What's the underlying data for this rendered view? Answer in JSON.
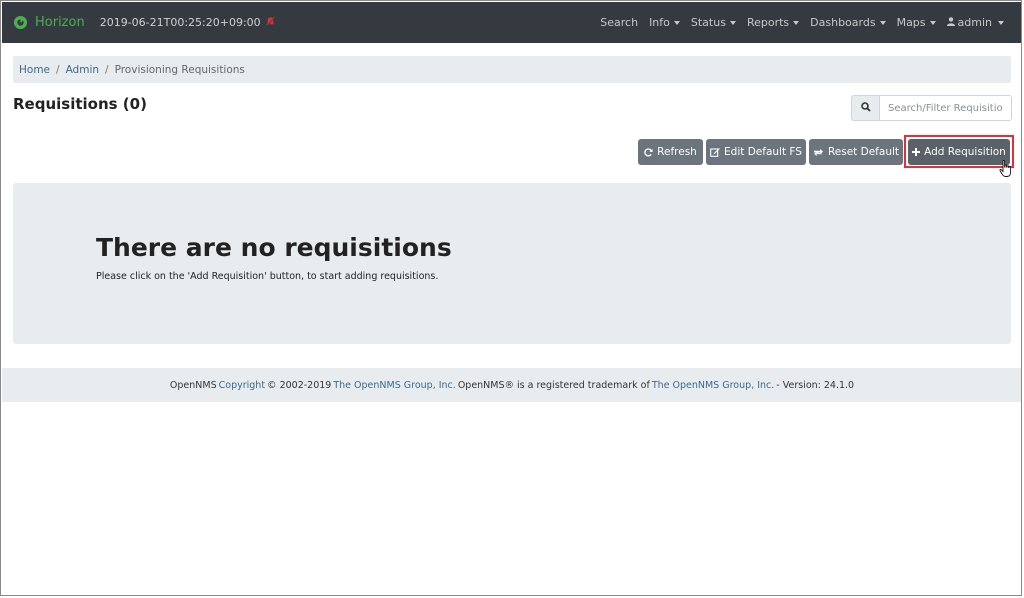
{
  "navbar": {
    "brand": "Horizon",
    "timestamp": "2019-06-21T00:25:20+09:00",
    "items": [
      {
        "label": "Search",
        "caret": false
      },
      {
        "label": "Info",
        "caret": true
      },
      {
        "label": "Status",
        "caret": true
      },
      {
        "label": "Reports",
        "caret": true
      },
      {
        "label": "Dashboards",
        "caret": true
      },
      {
        "label": "Maps",
        "caret": true
      }
    ],
    "user": "admin"
  },
  "breadcrumb": {
    "home": "Home",
    "admin": "Admin",
    "current": "Provisioning Requisitions",
    "separator": "/"
  },
  "page": {
    "title": "Requisitions (0)"
  },
  "search": {
    "placeholder": "Search/Filter Requisition",
    "value": ""
  },
  "actions": {
    "refresh": "Refresh",
    "edit_default_fs": "Edit Default FS",
    "reset_default": "Reset Default",
    "add_requisition": "Add Requisition"
  },
  "empty_state": {
    "title": "There are no requisitions",
    "text": "Please click on the 'Add Requisition' button, to start adding requisitions."
  },
  "footer": {
    "part1": "OpenNMS",
    "copyright_link": "Copyright",
    "part2": "© 2002-2019",
    "group_link_1": "The OpenNMS Group, Inc.",
    "part3": "OpenNMS® is a registered trademark of",
    "group_link_2": "The OpenNMS Group, Inc.",
    "part4": "- Version: 24.1.0"
  },
  "colors": {
    "navbar_bg": "#353a40",
    "brand_green": "#4caf50",
    "button_bg": "#6c757d",
    "highlight_red": "#e0303a",
    "link_blue": "#3b6a8f"
  },
  "icons": {
    "brand": "opennms-logo-icon",
    "notification": "bell-slash-icon",
    "user": "user-icon",
    "search": "search-icon",
    "refresh": "refresh-icon",
    "edit": "edit-icon",
    "reset": "reset-icon",
    "add": "plus-icon",
    "cursor": "hand-cursor-icon"
  }
}
